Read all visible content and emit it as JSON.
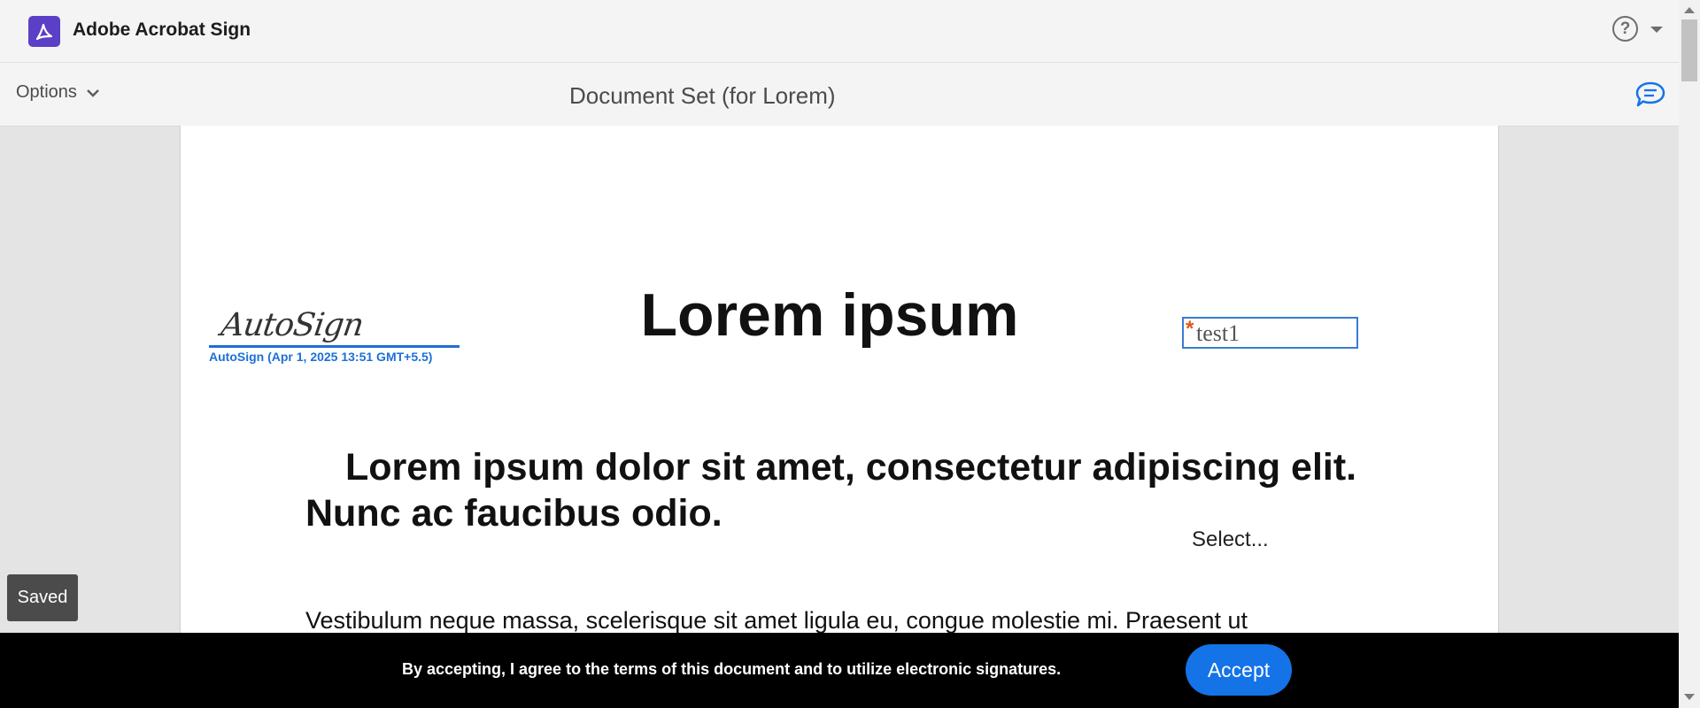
{
  "app": {
    "title": "Adobe Acrobat Sign",
    "logo_icon": "acrobat-logo-icon",
    "brand_color": "#5b3fc6"
  },
  "toolbar": {
    "options_label": "Options",
    "document_title": "Document Set (for Lorem)",
    "help_glyph": "?",
    "comment_icon": "comment-bubble-icon"
  },
  "document": {
    "signature_script": "AutoSign",
    "signature_caption": "AutoSign (Apr 1, 2025 13:51 GMT+5.5)",
    "heading": "Lorem ipsum",
    "field": {
      "required_marker": "*",
      "value": "test1"
    },
    "lead": "Lorem ipsum dolor sit amet, consectetur adipiscing elit. Nunc ac faucibus odio.",
    "select_placeholder": "Select...",
    "body_text": "Vestibulum neque massa, scelerisque sit amet ligula eu, congue molestie mi. Praesent ut"
  },
  "status": {
    "saved_label": "Saved"
  },
  "consent": {
    "text": "By accepting, I agree to the terms of this document and to utilize electronic signatures.",
    "accept_label": "Accept",
    "accent_color": "#1473e6"
  }
}
